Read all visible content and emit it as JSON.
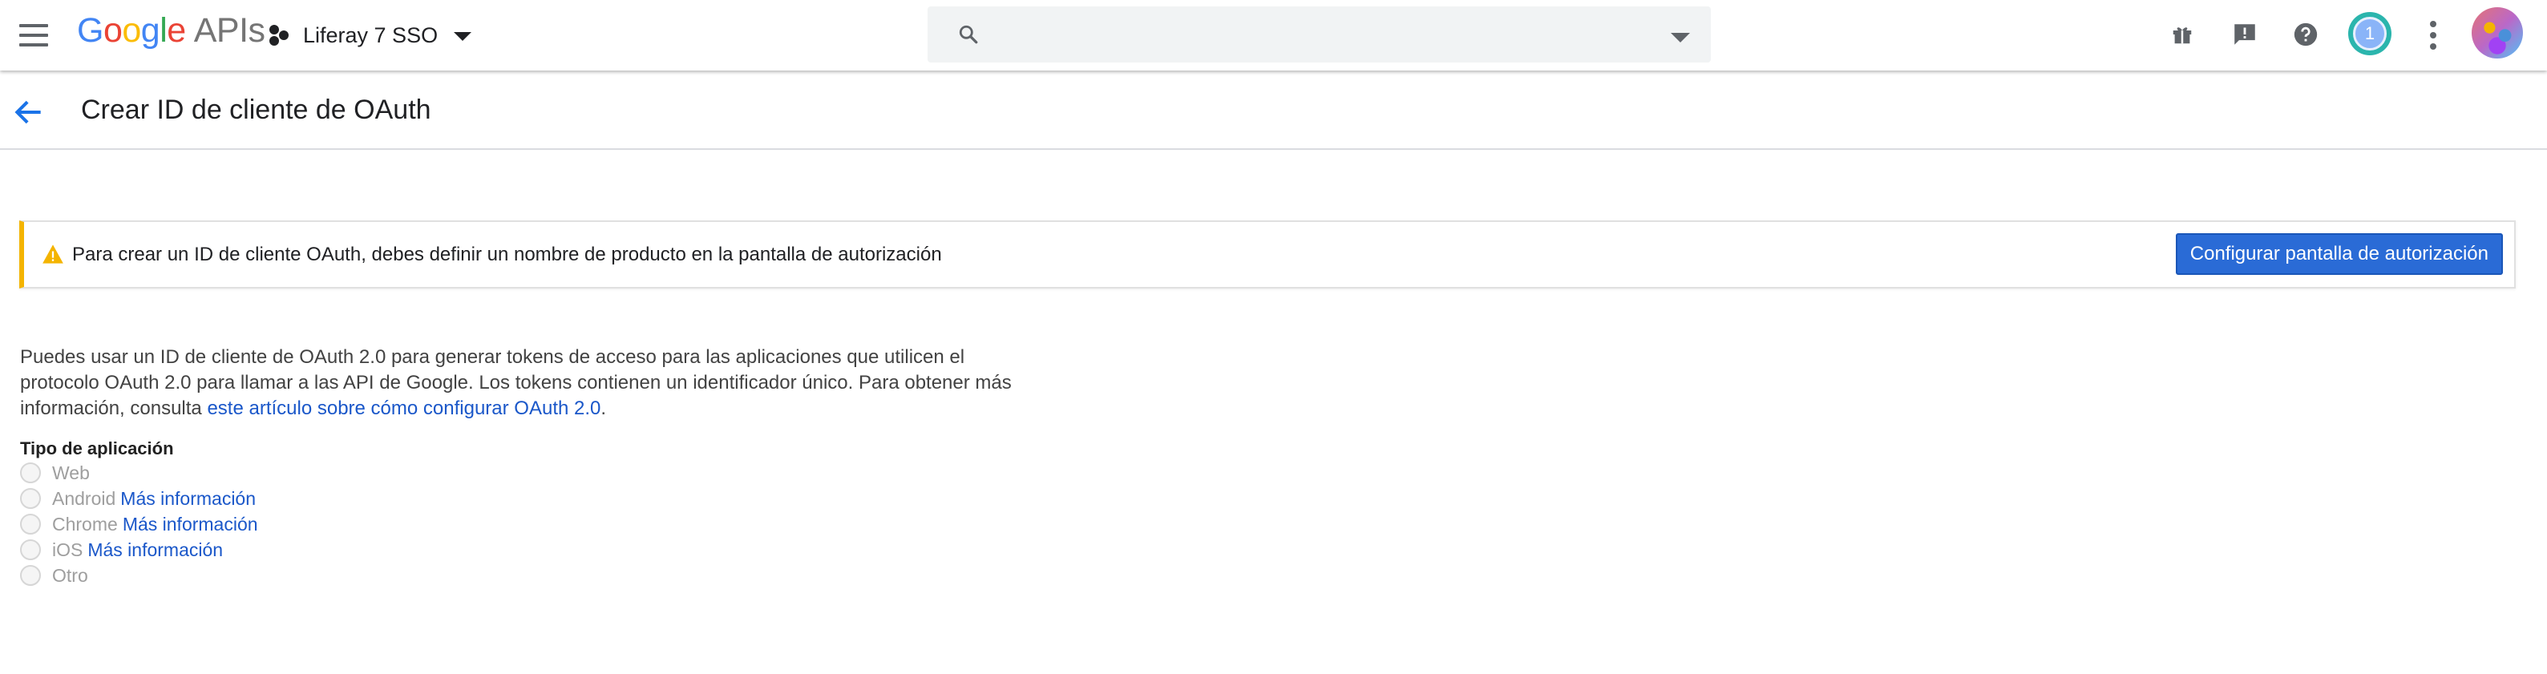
{
  "topbar": {
    "logo_google": [
      "G",
      "o",
      "o",
      "g",
      "l",
      "e"
    ],
    "logo_apis": "APIs",
    "project_name": "Liferay 7 SSO",
    "search_placeholder": "",
    "notification_count": "1"
  },
  "header": {
    "title": "Crear ID de cliente de OAuth"
  },
  "banner": {
    "message": "Para crear un ID de cliente OAuth, debes definir un nombre de producto en la pantalla de autorización",
    "button_label": "Configurar pantalla de autorización"
  },
  "description": {
    "text": "Puedes usar un ID de cliente de OAuth 2.0 para generar tokens de acceso para las aplicaciones que utilicen el protocolo OAuth 2.0 para llamar a las API de Google. Los tokens contienen un identificador único. Para obtener más información, consulta ",
    "link_text": "este artículo sobre cómo configurar OAuth 2.0",
    "suffix": "."
  },
  "app_type": {
    "label": "Tipo de aplicación",
    "options": [
      {
        "label": "Web",
        "link": ""
      },
      {
        "label": "Android",
        "link": "Más información"
      },
      {
        "label": "Chrome",
        "link": "Más información"
      },
      {
        "label": "iOS",
        "link": "Más información"
      },
      {
        "label": "Otro",
        "link": ""
      }
    ]
  },
  "colors": {
    "accent": "#2a6bd6",
    "link": "#1a57c9",
    "warning": "#f4b400"
  }
}
